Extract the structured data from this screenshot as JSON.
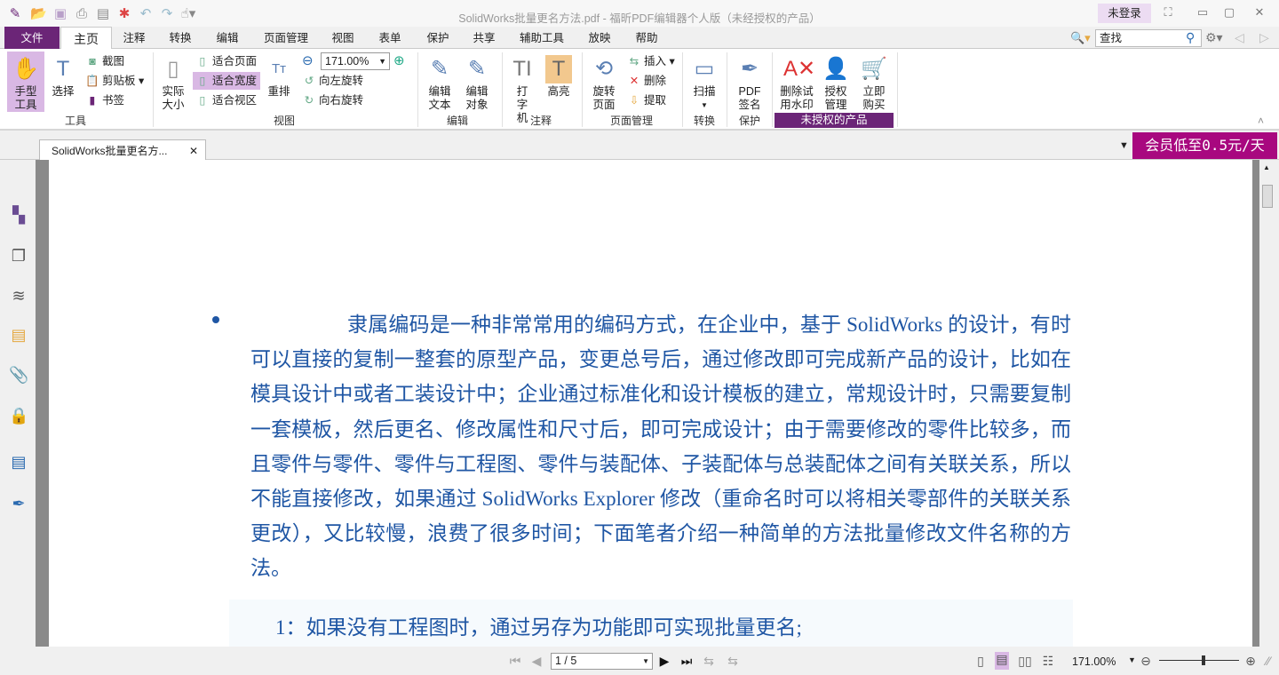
{
  "window": {
    "title": "SolidWorks批量更名方法.pdf - 福昕PDF编辑器个人版（未经授权的产品）",
    "login": "未登录"
  },
  "menu": {
    "tabs": [
      "文件",
      "主页",
      "注释",
      "转换",
      "编辑",
      "页面管理",
      "视图",
      "表单",
      "保护",
      "共享",
      "辅助工具",
      "放映",
      "帮助"
    ],
    "search_placeholder": "查找"
  },
  "ribbon": {
    "tools": {
      "hand": "手型工具",
      "select": "选择",
      "screenshot": "截图",
      "clipboard": "剪贴板",
      "bookmark": "书签",
      "group": "工具"
    },
    "view": {
      "actual": "实际大小",
      "fit_page": "适合页面",
      "fit_width": "适合宽度",
      "fit_visible": "适合视区",
      "reflow": "重排",
      "zoom": "171.00%",
      "rotate_left": "向左旋转",
      "rotate_right": "向右旋转",
      "group": "视图"
    },
    "edit": {
      "text": "编辑文本",
      "object": "编辑对象",
      "group": "编辑"
    },
    "comment": {
      "typewriter": "打字机",
      "highlight": "高亮",
      "group": "注释"
    },
    "pages": {
      "rotate": "旋转页面",
      "insert": "插入",
      "delete": "删除",
      "extract": "提取",
      "group": "页面管理"
    },
    "convert": {
      "scan": "扫描",
      "group": "转换"
    },
    "protect": {
      "sign": "PDF签名",
      "group": "保护"
    },
    "unlicensed": {
      "remove_watermark": "删除试用水印",
      "license": "授权管理",
      "buy": "立即购买",
      "group": "未授权的产品"
    }
  },
  "doc_tab": {
    "label": "SolidWorks批量更名方..."
  },
  "promo": "会员低至0.5元/天",
  "document": {
    "paragraph": "隶属编码是一种非常常用的编码方式，在企业中，基于 SolidWorks 的设计，有时可以直接的复制一整套的原型产品，变更总号后，通过修改即可完成新产品的设计，比如在模具设计中或者工装设计中；企业通过标准化和设计模板的建立，常规设计时，只需要复制一套模板，然后更名、修改属性和尺寸后，即可完成设计；由于需要修改的零件比较多，而且零件与零件、零件与工程图、零件与装配体、子装配体与总装配体之间有关联关系，所以不能直接修改，如果通过 SolidWorks Explorer 修改（重命名时可以将相关零部件的关联关系更改），又比较慢，浪费了很多时间；下面笔者介绍一种简单的方法批量修改文件名称的方法。",
    "item1": "1：如果没有工程图时，通过另存为功能即可实现批量更名;"
  },
  "status": {
    "page": "1 / 5",
    "zoom": "171.00%",
    "zoom_slider_fraction": 0.55
  }
}
